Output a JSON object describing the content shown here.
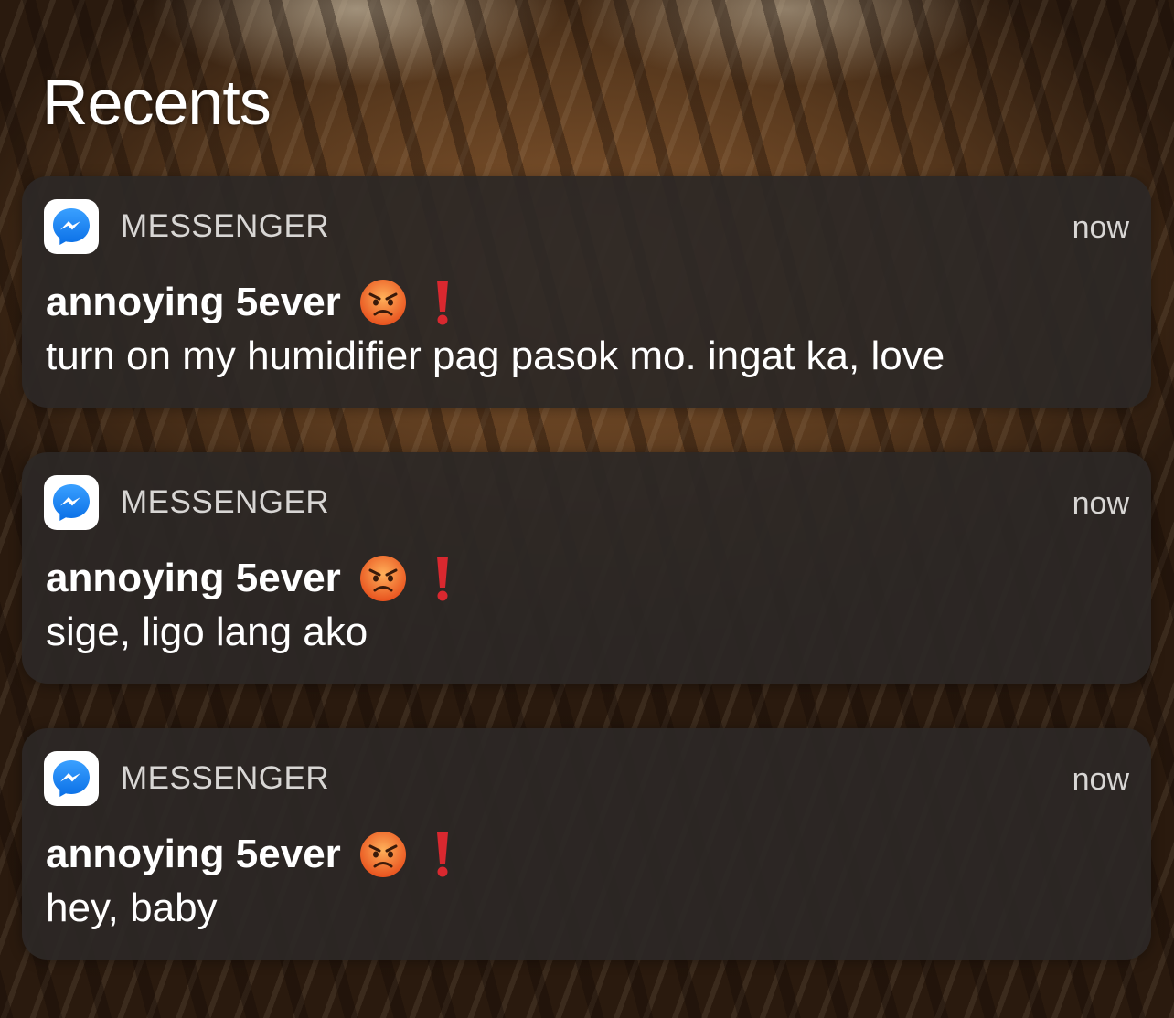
{
  "header": {
    "title": "Recents"
  },
  "notifications": [
    {
      "app_name": "MESSENGER",
      "app_icon": "messenger-icon",
      "time": "now",
      "sender": "annoying 5ever",
      "sender_emojis": [
        "angry-face-icon",
        "red-exclamation-icon"
      ],
      "message": "turn on my humidifier pag pasok mo. ingat ka, love"
    },
    {
      "app_name": "MESSENGER",
      "app_icon": "messenger-icon",
      "time": "now",
      "sender": "annoying 5ever",
      "sender_emojis": [
        "angry-face-icon",
        "red-exclamation-icon"
      ],
      "message": "sige, ligo lang ako"
    },
    {
      "app_name": "MESSENGER",
      "app_icon": "messenger-icon",
      "time": "now",
      "sender": "annoying 5ever",
      "sender_emojis": [
        "angry-face-icon",
        "red-exclamation-icon"
      ],
      "message": "hey, baby"
    }
  ],
  "colors": {
    "card_background": "#2c2826",
    "messenger_blue": "#1e88f5",
    "exclamation_red": "#d9282f",
    "angry_face": "#f06a28"
  }
}
